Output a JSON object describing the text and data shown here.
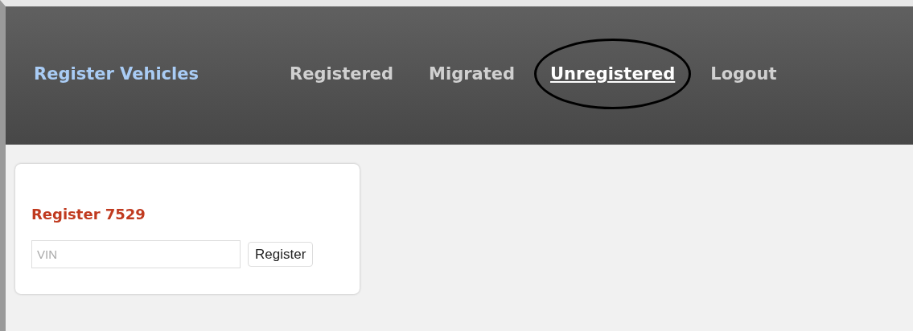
{
  "header": {
    "brand": "Register Vehicles",
    "nav": [
      {
        "label": "Registered",
        "selected": false,
        "circled": false
      },
      {
        "label": "Migrated",
        "selected": false,
        "circled": false
      },
      {
        "label": "Unregistered",
        "selected": true,
        "circled": true
      },
      {
        "label": "Logout",
        "selected": false,
        "circled": false
      }
    ]
  },
  "card": {
    "title": "Register 7529",
    "vin": {
      "placeholder": "VIN"
    },
    "button": "Register"
  }
}
